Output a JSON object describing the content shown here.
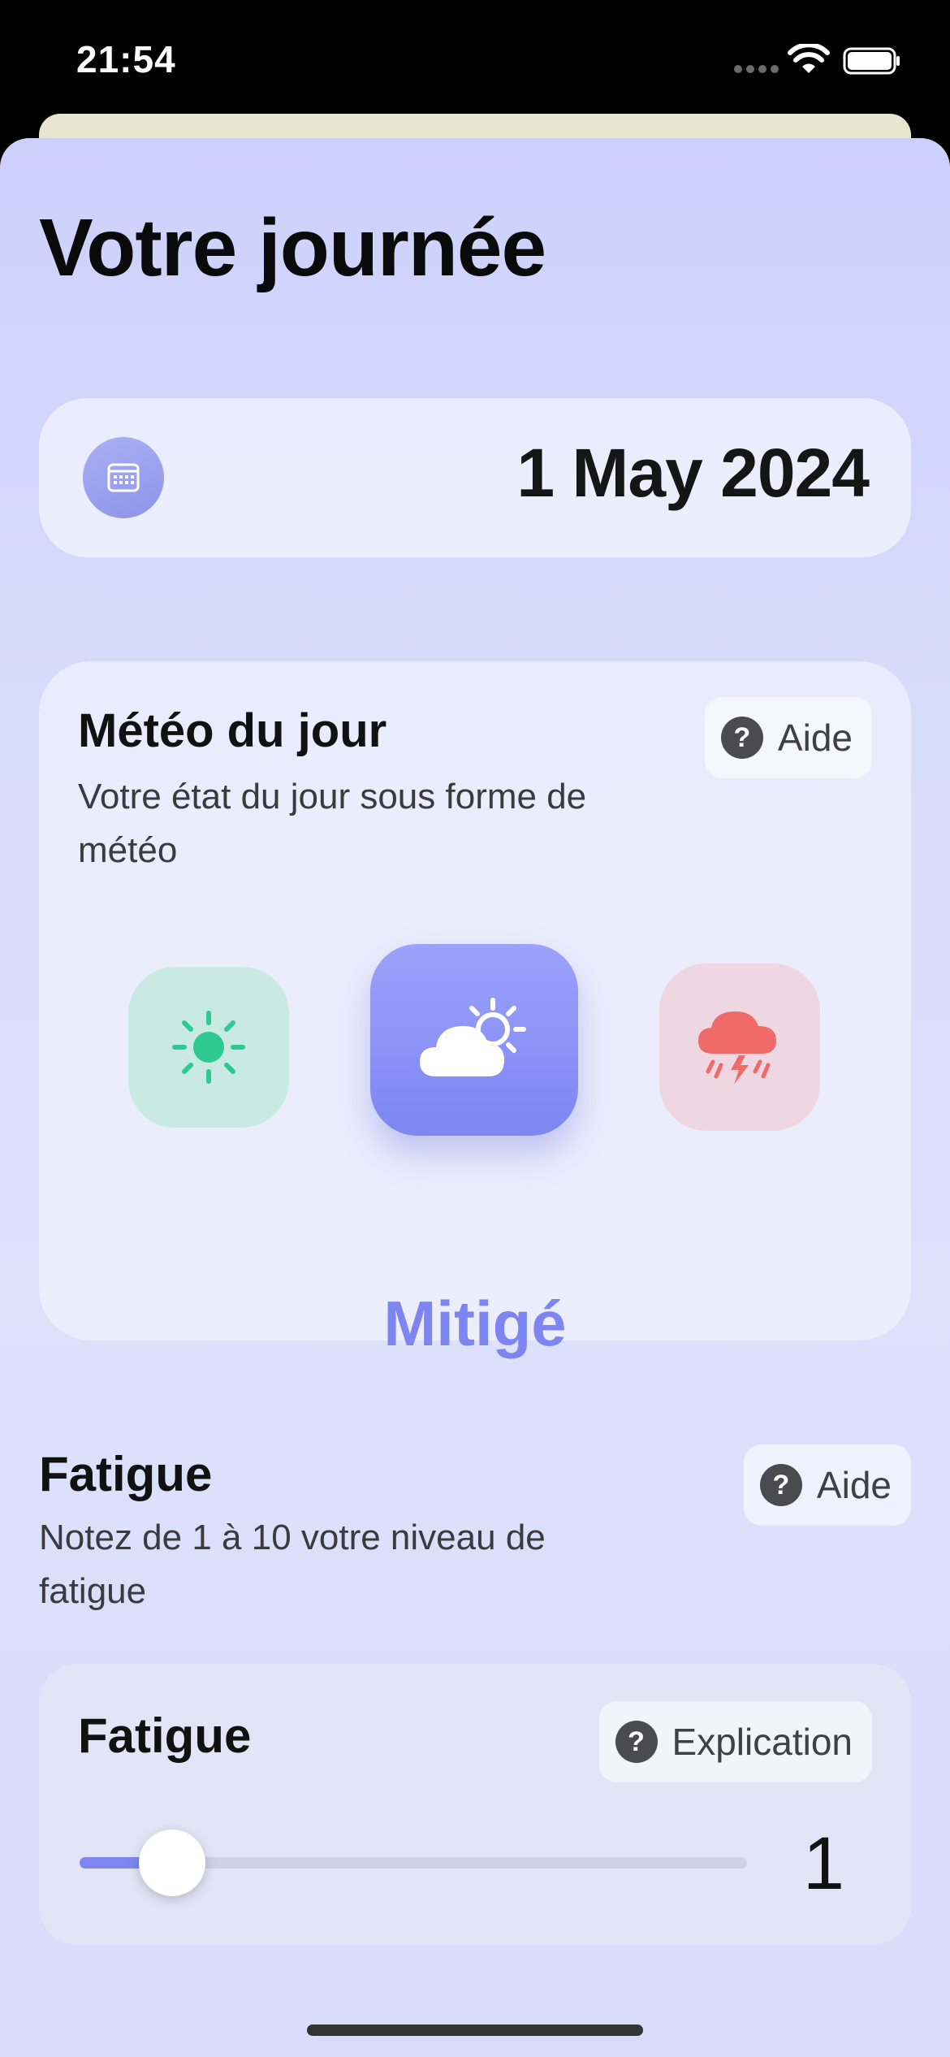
{
  "status_bar": {
    "time": "21:54"
  },
  "page": {
    "title": "Votre journée"
  },
  "date_picker": {
    "value": "1 May 2024",
    "icon": "calendar-icon"
  },
  "weather_card": {
    "title": "Météo du jour",
    "subtitle": "Votre état du jour sous forme de météo",
    "help_label": "Aide",
    "options": [
      {
        "icon": "sun-icon",
        "color": "#2ec98f"
      },
      {
        "icon": "cloud-sun-icon",
        "color": "#ffffff"
      },
      {
        "icon": "storm-cloud-icon",
        "color": "#f06a6a"
      }
    ],
    "selected_label": "Mitigé"
  },
  "fatigue_section": {
    "title": "Fatigue",
    "subtitle": "Notez de 1 à 10 votre niveau de fatigue",
    "help_label": "Aide",
    "slider": {
      "title": "Fatigue",
      "explain_label": "Explication",
      "value": "1",
      "level": 1,
      "min": 1,
      "max": 10
    }
  },
  "colors": {
    "accent": "#7d86f2",
    "background": "#d8dcfb"
  }
}
